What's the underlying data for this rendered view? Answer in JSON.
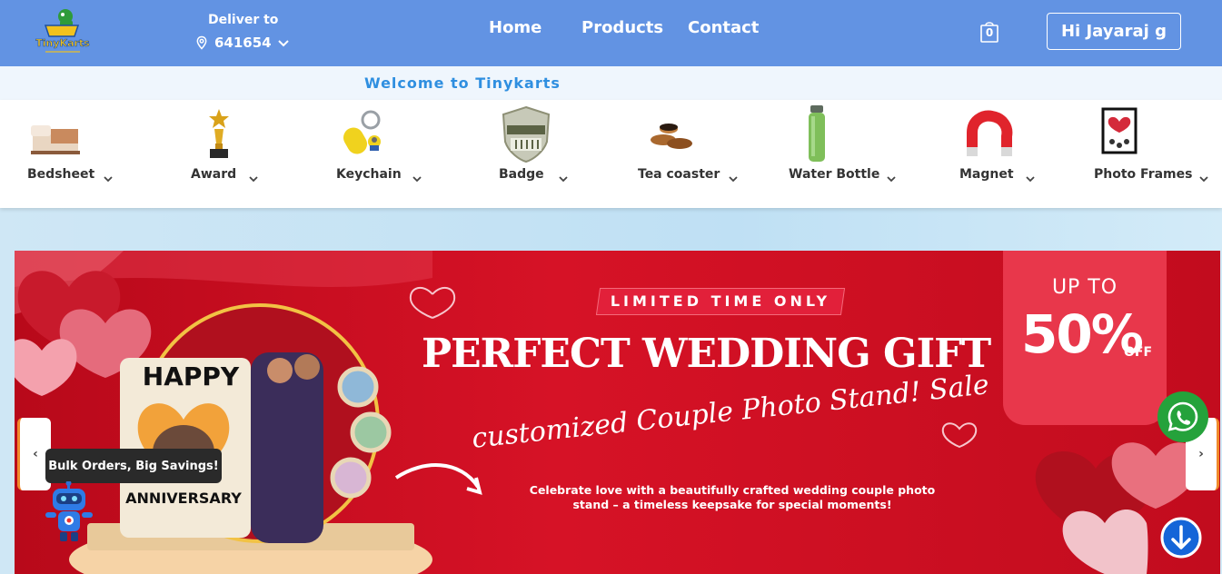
{
  "header": {
    "logo_text": "TinyKarts",
    "deliver_label": "Deliver to",
    "pincode": "641654",
    "nav": [
      "Home",
      "Products",
      "Contact"
    ],
    "cart_count": "0",
    "user_greeting": "Hi Jayaraj g",
    "bg_color": "#6293e3"
  },
  "welcome": {
    "text": "Welcome to Tinykarts"
  },
  "categories": [
    {
      "label": "Bedsheet",
      "icon": "bedsheet-icon"
    },
    {
      "label": "Award",
      "icon": "trophy-icon"
    },
    {
      "label": "Keychain",
      "icon": "keychain-icon"
    },
    {
      "label": "Badge",
      "icon": "badge-icon"
    },
    {
      "label": "Tea coaster",
      "icon": "tea-coaster-icon"
    },
    {
      "label": "Water Bottle",
      "icon": "water-bottle-icon"
    },
    {
      "label": "Magnet",
      "icon": "magnet-icon"
    },
    {
      "label": "Photo Frames",
      "icon": "photo-frame-icon"
    }
  ],
  "banner": {
    "limited": "LIMITED TIME ONLY",
    "title": "PERFECT WEDDING GIFT",
    "script": "customized Couple Photo Stand! Sale",
    "description": "Celebrate love with a beautifully crafted wedding couple photo stand – a timeless keepsake for special moments!",
    "promo_upto": "UP TO",
    "promo_percent": "50%",
    "promo_off": "OFF",
    "stand_happy": "HAPPY",
    "stand_anniversary": "ANNIVERSARY",
    "accent": "#d61226"
  },
  "carousel": {
    "prev": "‹",
    "next": "›"
  },
  "tooltip": "Bulk Orders, Big Savings!"
}
